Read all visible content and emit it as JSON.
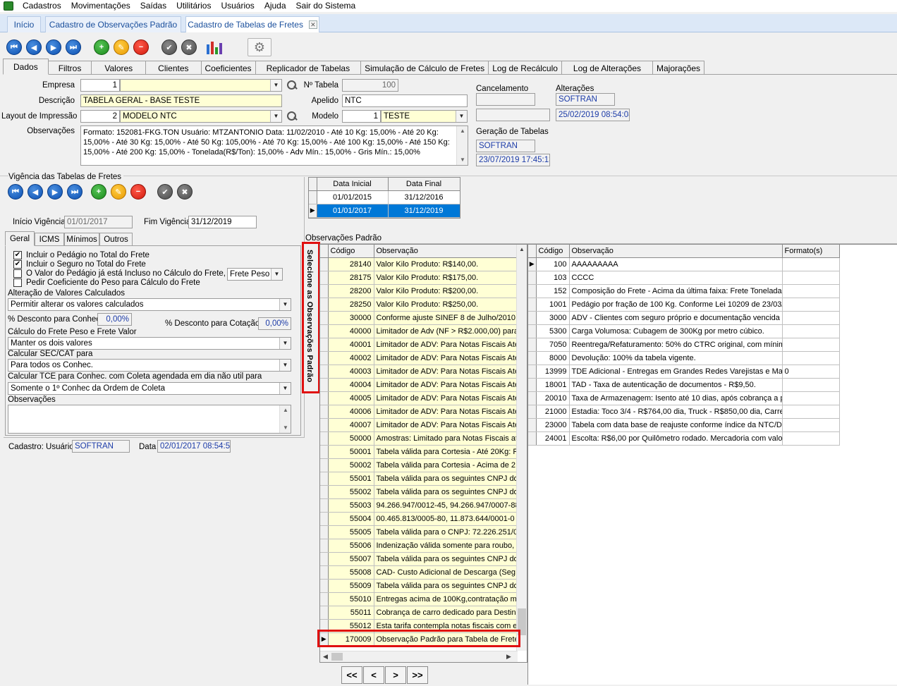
{
  "menu": [
    "Cadastros",
    "Movimentações",
    "Saídas",
    "Utilitários",
    "Usuários",
    "Ajuda",
    "Sair do Sistema"
  ],
  "doc_tabs": {
    "t1": "Início",
    "t2": "Cadastro de Observações Padrão",
    "t3": "Cadastro de Tabelas de Fretes"
  },
  "main_tabs": [
    "Dados",
    "Filtros",
    "Valores",
    "Clientes",
    "Coeficientes",
    "Replicador de Tabelas",
    "Simulação de Cálculo de Fretes",
    "Log de Recálculo",
    "Log de Alterações",
    "Majorações"
  ],
  "form": {
    "empresa_label": "Empresa",
    "empresa_code": "1",
    "empresa_name": "",
    "descricao_label": "Descrição",
    "descricao": "TABELA GERAL - BASE TESTE",
    "layout_label": "Layout de Impressão",
    "layout_code": "2",
    "layout_name": "MODELO NTC",
    "obs_label": "Observações",
    "obs_text": "Formato: 152081-FKG.TON    Usuário: MTZANTONIO Data: 11/02/2010  - Até 10 Kg:   15,00% - Até 20 Kg:   15,00% - Até 30 Kg:   15,00% - Até 50 Kg:   105,00% - Até 70 Kg:   15,00% - Até 100 Kg:   15,00% - Até 150 Kg:   15,00% - Até 200 Kg:   15,00% - Tonelada(R$/Ton):   15,00% - Adv Mín.:   15,00% - Gris Mín.:   15,00%",
    "ntabela_label": "Nº Tabela",
    "ntabela": "100",
    "apelido_label": "Apelido",
    "apelido": "NTC",
    "modelo_label": "Modelo",
    "modelo_code": "1",
    "modelo_name": "TESTE",
    "cancelamento_label": "Cancelamento",
    "alteracoes_label": "Alterações",
    "alt_user": "SOFTRAN",
    "alt_date": "25/02/2019 08:54:08",
    "geracao_label": "Geração de Tabelas",
    "ger_user": "SOFTRAN",
    "ger_date": "23/07/2019 17:45:13"
  },
  "vigencia": {
    "title": "Vigência das Tabelas de Fretes",
    "inicio_label": "Início Vigência",
    "inicio": "01/01/2017",
    "fim_label": "Fim Vigência",
    "fim": "31/12/2019",
    "grid_headers": [
      "Data Inicial",
      "Data Final"
    ],
    "rows": [
      [
        "01/01/2015",
        "31/12/2016"
      ],
      [
        "01/01/2017",
        "31/12/2019"
      ]
    ]
  },
  "subtabs": [
    "Geral",
    "ICMS",
    "Mínimos",
    "Outros"
  ],
  "geral": {
    "chk1": "Incluir o Pedágio no Total do Frete",
    "chk2": "Incluir o Seguro no Total do Frete",
    "chk3": "O Valor do Pedágio já está Incluso no Cálculo do Frete, em",
    "chk3_select": "Frete Peso",
    "chk4": "Pedir Coeficiente do Peso para Cálculo do Frete",
    "alt_label": "Alteração de Valores Calculados",
    "alt_value": "Permitir alterar os valores calculados",
    "desc_conhec_label": "% Desconto para Conhec.",
    "desc_conhec": "0,00%",
    "desc_cot_label": "% Desconto para Cotação",
    "desc_cot": "0,00%",
    "calc_label": "Cálculo do Frete Peso e Frete Valor",
    "calc_value": "Manter os dois valores",
    "sec_label": "Calcular SEC/CAT para",
    "sec_value": "Para todos os Conhec.",
    "tce_label": "Calcular TCE para Conhec. com  Coleta agendada em dia não util para",
    "tce_value": "Somente o 1º Conhec da Ordem de Coleta",
    "obs_label": "Observações",
    "cad_label": "Cadastro: Usuário",
    "cad_user": "SOFTRAN",
    "data_label": "Data",
    "cad_date": "02/01/2017 08:54:58"
  },
  "obs_padrao": {
    "title": "Observações Padrão",
    "vertical_label": "Selecione as Observações Padrão",
    "left_headers": [
      "Código",
      "Observação"
    ],
    "left_rows": [
      [
        "28140",
        "Valor Kilo Produto: R$140,00."
      ],
      [
        "28175",
        "Valor Kilo Produto: R$175,00."
      ],
      [
        "28200",
        "Valor Kilo Produto: R$200,00."
      ],
      [
        "28250",
        "Valor Kilo Produto: R$250,00."
      ],
      [
        "30000",
        "Conforme ajuste SINEF 8 de Julho/2010, d"
      ],
      [
        "40000",
        "Limitador de  Adv (NF > R$2.000,00) para"
      ],
      [
        "40001",
        "Limitador de ADV: Para Notas Fiscais Até"
      ],
      [
        "40002",
        "Limitador de ADV: Para Notas Fiscais Até"
      ],
      [
        "40003",
        "Limitador de ADV: Para Notas Fiscais Até"
      ],
      [
        "40004",
        "Limitador de ADV: Para Notas Fiscais Até"
      ],
      [
        "40005",
        "Limitador de ADV: Para Notas Fiscais Até"
      ],
      [
        "40006",
        "Limitador de ADV: Para Notas Fiscais Até"
      ],
      [
        "40007",
        "Limitador de ADV: Para Notas Fiscais Até"
      ],
      [
        "50000",
        "Amostras: Limitado para Notas Fiscais até"
      ],
      [
        "50001",
        "Tabela válida para Cortesia - Até 20Kg: F"
      ],
      [
        "50002",
        "Tabela válida para Cortesia - Acima de 2"
      ],
      [
        "55001",
        "Tabela válida para os seguintes CNPJ do"
      ],
      [
        "55002",
        "Tabela válida para os seguintes CNPJ do"
      ],
      [
        "55003",
        "94.266.947/0012-45, 94.266.947/0007-88"
      ],
      [
        "55004",
        "00.465.813/0005-80, 11.873.644/0001-0"
      ],
      [
        "55005",
        "Tabela válida para o CNPJ: 72.226.251/00"
      ],
      [
        "55006",
        "Indenização válida somente para roubo, s"
      ],
      [
        "55007",
        "Tabela válida para os seguintes CNPJ do"
      ],
      [
        "55008",
        "CAD- Custo Adicional de Descarga (Seg"
      ],
      [
        "55009",
        "Tabela válida para os seguintes CNPJ do"
      ],
      [
        "55010",
        "Entregas acima de 100Kg,contratação m"
      ],
      [
        "55011",
        "Cobrança de carro dedicado para Destin"
      ],
      [
        "55012",
        "Esta tarifa contempla notas fiscais com e"
      ],
      [
        "170009",
        "Observação Padrão para Tabela de Frete"
      ]
    ],
    "right_headers": [
      "Código",
      "Observação",
      "Formato(s)"
    ],
    "right_rows": [
      [
        "100",
        "AAAAAAAAA",
        ""
      ],
      [
        "103",
        "CCCC",
        ""
      ],
      [
        "152",
        "Composição do Frete - Acima da última faixa: Frete Tonelada -",
        ""
      ],
      [
        "1001",
        "Pedágio por fração de 100 Kg. Conforme Lei 10209 de 23/03/2",
        ""
      ],
      [
        "3000",
        "ADV - Clientes com seguro próprio e documentação vencida e",
        ""
      ],
      [
        "5300",
        "Carga Volumosa: Cubagem de 300Kg por metro cúbico.",
        ""
      ],
      [
        "7050",
        "Reentrega/Refaturamento: 50% do CTRC original, com mínimo",
        ""
      ],
      [
        "8000",
        "Devolução: 100% da tabela vigente.",
        ""
      ],
      [
        "13999",
        "TDE Adicional - Entregas em Grandes Redes Varejistas e Mag",
        "0"
      ],
      [
        "18001",
        "TAD - Taxa de autenticação de documentos - R$9,50.",
        ""
      ],
      [
        "20010",
        "Taxa de Armazenagem: Isento até 10 dias, após cobrança a p",
        ""
      ],
      [
        "21000",
        "Estadia: Toco 3/4 - R$764,00 dia, Truck - R$850,00 dia, Carret",
        ""
      ],
      [
        "23000",
        "Tabela com data base de reajuste conforme índice da NTC/DE",
        ""
      ],
      [
        "24001",
        "Escolta: R$6,00 por Quilômetro rodado. Mercadoria com valor",
        ""
      ]
    ],
    "nav": [
      "<<",
      "<",
      ">",
      ">>"
    ]
  }
}
